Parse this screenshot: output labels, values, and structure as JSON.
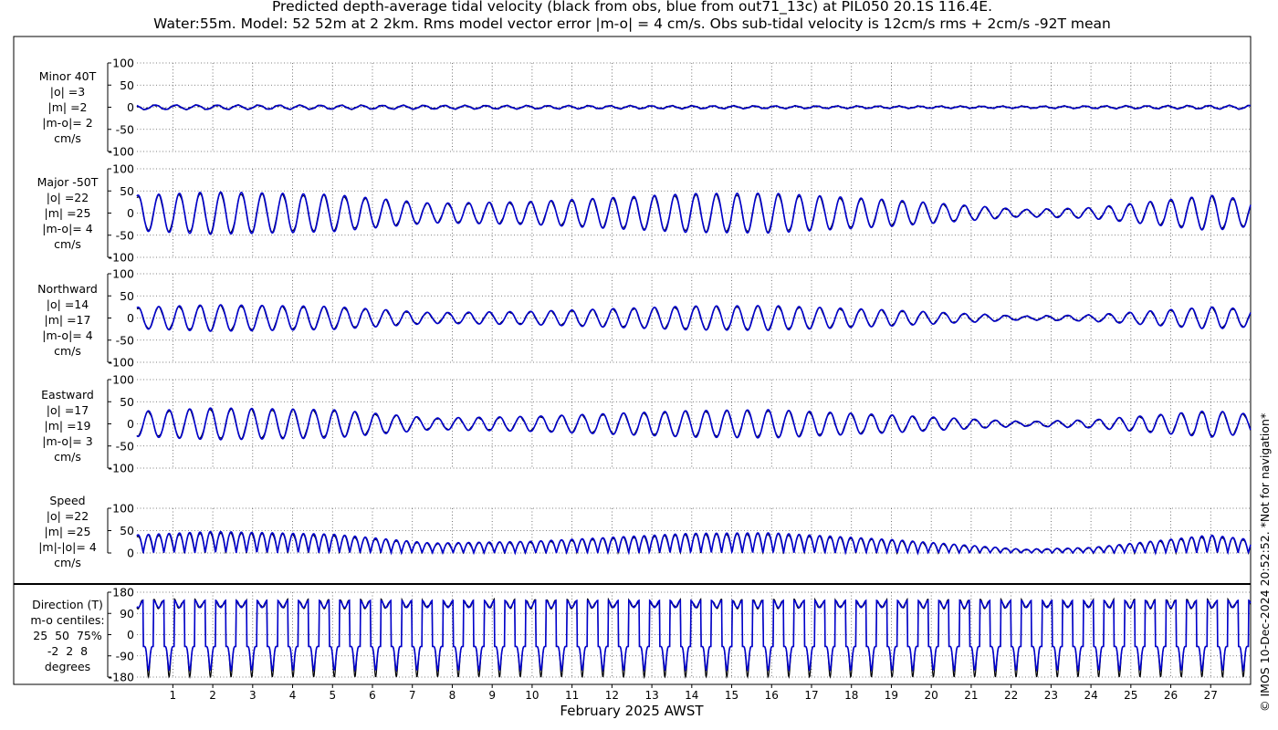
{
  "title": {
    "line1": "Predicted depth-average tidal velocity (black from obs, blue from out71_13c) at PIL050 20.1S 116.4E.",
    "line2": "Water:55m. Model: 52 52m at 2 2km. Rms model vector error |m-o| = 4 cm/s. Obs sub-tidal velocity is 12cm/s rms + 2cm/s -92T mean"
  },
  "watermark": "© IMOS 10-Dec-2024 20:52:52. *Not for navigation*",
  "colors": {
    "obs": "#000000",
    "model": "#0000cc",
    "grid": "#555555"
  },
  "chart_data": {
    "type": "line",
    "xlabel": "February 2025 AWST",
    "x_ticks": [
      "1",
      "2",
      "3",
      "4",
      "5",
      "6",
      "7",
      "8",
      "9",
      "10",
      "11",
      "12",
      "13",
      "14",
      "15",
      "16",
      "17",
      "18",
      "19",
      "20",
      "21",
      "22",
      "23",
      "24",
      "25",
      "26",
      "27"
    ],
    "xlim": [
      0.1,
      28
    ],
    "series_legend": [
      "black from obs",
      "blue from out71_13c"
    ],
    "grid": true,
    "panels": [
      {
        "label": [
          "Minor 40T",
          "|o| =3",
          "|m| =2",
          "|m-o|= 2",
          "cm/s"
        ],
        "ylim": [
          -100,
          100
        ],
        "yticks": [
          "100",
          "50",
          "0",
          "-50",
          "-100"
        ],
        "tick_values": [
          100,
          50,
          0,
          -50,
          -100
        ],
        "amplitude_envelope": {
          "days": [
            0,
            14,
            22,
            28
          ],
          "values": [
            5,
            3,
            2,
            4
          ]
        },
        "phase_deg": 60
      },
      {
        "label": [
          "Major -50T",
          "|o| =22",
          "|m| =25",
          "|m-o|= 4",
          "cm/s"
        ],
        "ylim": [
          -100,
          100
        ],
        "yticks": [
          "100",
          "50",
          "0",
          "-50",
          "-100"
        ],
        "tick_values": [
          100,
          50,
          0,
          -50,
          -100
        ],
        "amplitude_envelope": {
          "days": [
            0,
            2,
            5,
            7.5,
            10,
            14,
            16,
            19,
            22.3,
            24,
            27,
            28
          ],
          "values": [
            40,
            48,
            42,
            22,
            26,
            44,
            45,
            30,
            8,
            12,
            40,
            30
          ]
        },
        "phase_deg": 0
      },
      {
        "label": [
          "Northward",
          "|o| =14",
          "|m| =17",
          "|m-o|= 4",
          "cm/s"
        ],
        "ylim": [
          -100,
          100
        ],
        "yticks": [
          "100",
          "50",
          "0",
          "-50",
          "-100"
        ],
        "tick_values": [
          100,
          50,
          0,
          -50,
          -100
        ],
        "amplitude_envelope": {
          "days": [
            0,
            2,
            5,
            7.5,
            10,
            14,
            16,
            19,
            22.3,
            24,
            27,
            28
          ],
          "values": [
            24,
            30,
            26,
            12,
            15,
            27,
            28,
            18,
            4,
            7,
            25,
            20
          ]
        },
        "phase_deg": 0
      },
      {
        "label": [
          "Eastward",
          "|o| =17",
          "|m| =19",
          "|m-o|= 3",
          "cm/s"
        ],
        "ylim": [
          -100,
          100
        ],
        "yticks": [
          "100",
          "50",
          "0",
          "-50",
          "-100"
        ],
        "tick_values": [
          100,
          50,
          0,
          -50,
          -100
        ],
        "amplitude_envelope": {
          "days": [
            0,
            2,
            5,
            7.5,
            10,
            14,
            16,
            19,
            22.3,
            24,
            27,
            28
          ],
          "values": [
            28,
            36,
            32,
            13,
            17,
            30,
            32,
            20,
            5,
            9,
            30,
            22
          ]
        },
        "phase_deg": 180
      },
      {
        "label": [
          "Speed",
          "|o| =22",
          "|m| =25",
          "|m|-|o|= 4",
          "cm/s"
        ],
        "ylim": [
          0,
          100
        ],
        "yticks": [
          "100",
          "50",
          "0"
        ],
        "tick_values": [
          100,
          50,
          0
        ],
        "amplitude_envelope": {
          "days": [
            0,
            2,
            5,
            7.5,
            10,
            14,
            16,
            19,
            22.3,
            24,
            27,
            28
          ],
          "values": [
            40,
            48,
            42,
            22,
            26,
            44,
            45,
            30,
            8,
            12,
            40,
            30
          ]
        },
        "phase_deg": 0
      },
      {
        "label": [
          "Direction (T)",
          "m-o centiles:",
          "25  50  75%",
          "-2  2  8",
          "degrees"
        ],
        "ylim": [
          -180,
          180
        ],
        "yticks": [
          "180",
          "90",
          "0",
          "-90",
          "-180"
        ],
        "tick_values": [
          180,
          90,
          0,
          -90,
          -180
        ],
        "flood_dir": 130,
        "ebb_dir": -50
      }
    ],
    "tidal_period_hours": 12.42
  }
}
